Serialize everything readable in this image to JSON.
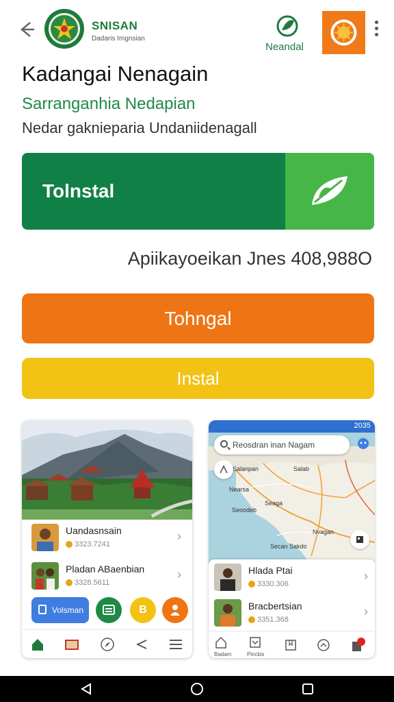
{
  "header": {
    "brand_name": "SNISAN",
    "brand_sub": "Dadaris Imgnsian",
    "partner_label": "Neandal"
  },
  "app": {
    "title": "Kadangai Nenagain",
    "subtitle": "Sarranganhia Nedapian",
    "description": "Nedar gaknieparia Undaniidenagall",
    "install_main_label": "Tolnstal",
    "downloads_text": "Apiikayoeikan Jnes 408,988O",
    "orange_button_label": "Tohngal",
    "yellow_button_label": "Instal"
  },
  "screenshot_left": {
    "items": [
      {
        "name": "Uandasnsain",
        "meta": "3323.7241"
      },
      {
        "name": "Pladan ABaenbian",
        "meta": "3328.5611"
      }
    ],
    "pill_button_label": "Volsman",
    "circle_b_label": "B"
  },
  "screenshot_right": {
    "status_time": "2035",
    "search_placeholder": "Reosdran inan Nagam",
    "map_labels": [
      "Salanpan",
      "Salab",
      "Nearsa",
      "Seaga",
      "Seoodeb",
      "Nvagan",
      "Secan Sakdo"
    ],
    "items": [
      {
        "name": "Hlada Ptai",
        "meta": "3330.306"
      },
      {
        "name": "Bracbertsian",
        "meta": "3351.368"
      }
    ],
    "nav_labels": [
      "Badam",
      "Pinckis"
    ]
  },
  "colors": {
    "green_dark": "#118046",
    "green_light": "#46b649",
    "orange": "#ef7514",
    "yellow": "#f2c315",
    "blue": "#3f7de0"
  }
}
